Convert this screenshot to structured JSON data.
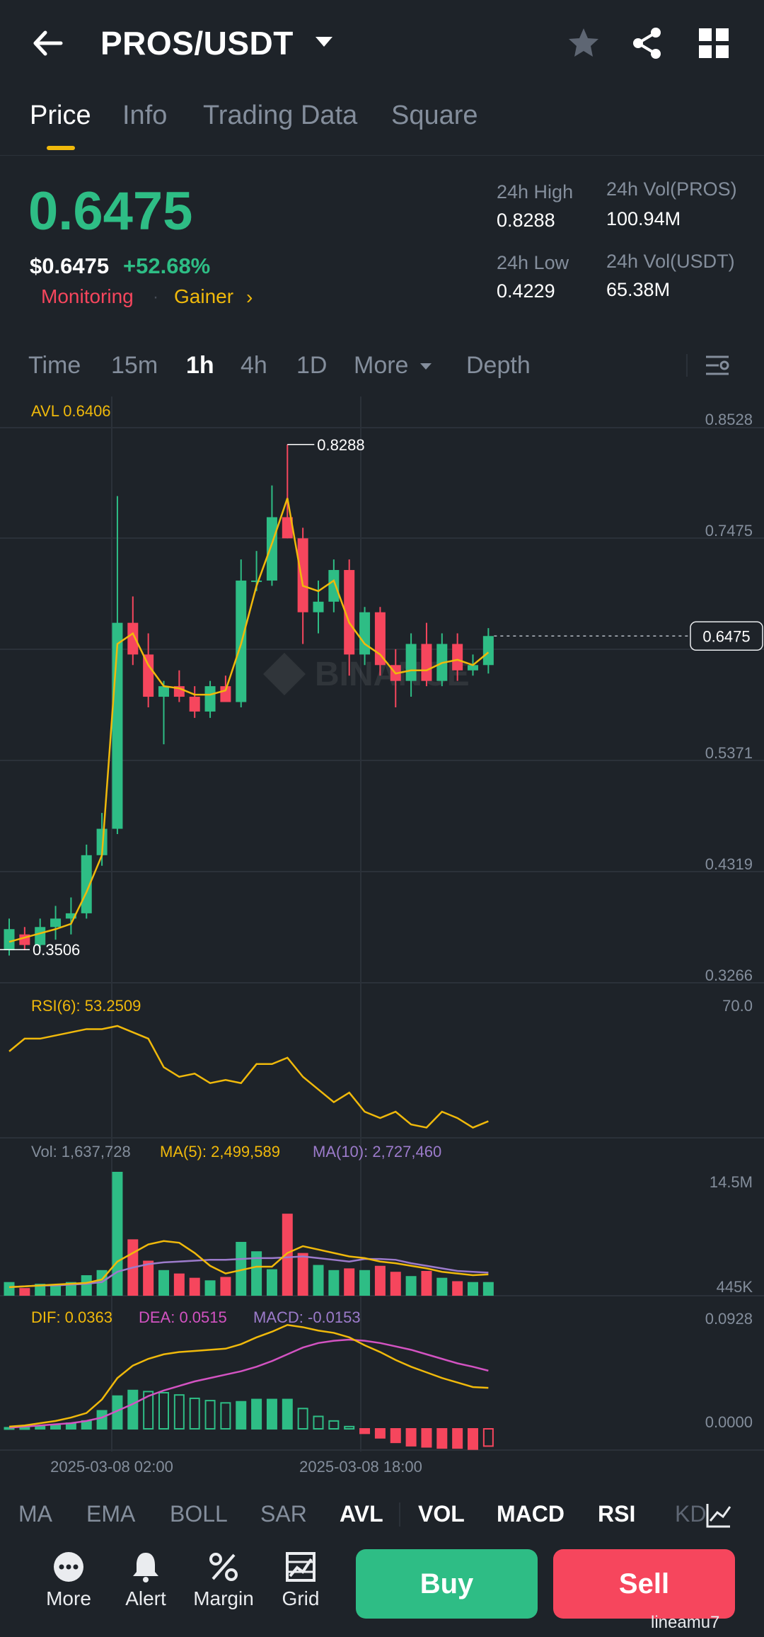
{
  "header": {
    "pair": "PROS/USDT",
    "icons": [
      "back-arrow-icon",
      "caret-down-icon",
      "star-icon",
      "share-icon",
      "grid-icon"
    ]
  },
  "tabs": [
    {
      "label": "Price",
      "active": true
    },
    {
      "label": "Info",
      "active": false
    },
    {
      "label": "Trading Data",
      "active": false
    },
    {
      "label": "Square",
      "active": false
    }
  ],
  "ticker": {
    "last_price": "0.6475",
    "usd_price": "$0.6475",
    "change_pct": "+52.68%",
    "tag_monitoring": "Monitoring",
    "tag_gainer": "Gainer",
    "high_label": "24h High",
    "high_value": "0.8288",
    "low_label": "24h Low",
    "low_value": "0.4229",
    "vol_base_label": "24h Vol(PROS)",
    "vol_base_value": "100.94M",
    "vol_quote_label": "24h Vol(USDT)",
    "vol_quote_value": "65.38M"
  },
  "intervals": [
    {
      "label": "Time",
      "active": false
    },
    {
      "label": "15m",
      "active": false
    },
    {
      "label": "1h",
      "active": true
    },
    {
      "label": "4h",
      "active": false
    },
    {
      "label": "1D",
      "active": false
    },
    {
      "label": "More",
      "active": false
    },
    {
      "label": "Depth",
      "active": false
    }
  ],
  "colors": {
    "up": "#2ebd85",
    "down": "#f6465d",
    "accent": "#f0b90b",
    "purple": "#9c7bcb",
    "pink": "#d353c2",
    "background": "#1e2329"
  },
  "chart_data": {
    "type": "candlestick",
    "interval": "1h",
    "avl_label": "AVL 0.6406",
    "price_ticks": [
      "0.8528",
      "0.7475",
      "0.6475",
      "0.5371",
      "0.4319",
      "0.3266"
    ],
    "y_range": [
      0.3266,
      0.8528
    ],
    "current_price": "0.6475",
    "high_marker": "0.8288",
    "low_marker": "0.3506",
    "x_tick_labels": [
      "2025-03-08 02:00",
      "2025-03-08 18:00"
    ],
    "candles": [
      {
        "o": 0.35,
        "h": 0.38,
        "l": 0.345,
        "c": 0.37
      },
      {
        "o": 0.365,
        "h": 0.372,
        "l": 0.35,
        "c": 0.355
      },
      {
        "o": 0.355,
        "h": 0.38,
        "l": 0.352,
        "c": 0.372
      },
      {
        "o": 0.372,
        "h": 0.392,
        "l": 0.36,
        "c": 0.38
      },
      {
        "o": 0.38,
        "h": 0.4,
        "l": 0.365,
        "c": 0.385
      },
      {
        "o": 0.385,
        "h": 0.45,
        "l": 0.38,
        "c": 0.44
      },
      {
        "o": 0.44,
        "h": 0.48,
        "l": 0.43,
        "c": 0.465
      },
      {
        "o": 0.465,
        "h": 0.78,
        "l": 0.46,
        "c": 0.66
      },
      {
        "o": 0.66,
        "h": 0.685,
        "l": 0.62,
        "c": 0.63
      },
      {
        "o": 0.63,
        "h": 0.65,
        "l": 0.58,
        "c": 0.59
      },
      {
        "o": 0.59,
        "h": 0.605,
        "l": 0.545,
        "c": 0.6
      },
      {
        "o": 0.6,
        "h": 0.615,
        "l": 0.585,
        "c": 0.59
      },
      {
        "o": 0.59,
        "h": 0.6,
        "l": 0.57,
        "c": 0.576
      },
      {
        "o": 0.576,
        "h": 0.605,
        "l": 0.57,
        "c": 0.6
      },
      {
        "o": 0.6,
        "h": 0.61,
        "l": 0.585,
        "c": 0.585
      },
      {
        "o": 0.585,
        "h": 0.72,
        "l": 0.58,
        "c": 0.7
      },
      {
        "o": 0.7,
        "h": 0.728,
        "l": 0.69,
        "c": 0.7
      },
      {
        "o": 0.7,
        "h": 0.79,
        "l": 0.695,
        "c": 0.76
      },
      {
        "o": 0.76,
        "h": 0.8288,
        "l": 0.74,
        "c": 0.74
      },
      {
        "o": 0.74,
        "h": 0.75,
        "l": 0.64,
        "c": 0.67
      },
      {
        "o": 0.67,
        "h": 0.7,
        "l": 0.65,
        "c": 0.68
      },
      {
        "o": 0.68,
        "h": 0.72,
        "l": 0.67,
        "c": 0.71
      },
      {
        "o": 0.71,
        "h": 0.72,
        "l": 0.61,
        "c": 0.63
      },
      {
        "o": 0.63,
        "h": 0.675,
        "l": 0.62,
        "c": 0.67
      },
      {
        "o": 0.67,
        "h": 0.675,
        "l": 0.61,
        "c": 0.62
      },
      {
        "o": 0.62,
        "h": 0.635,
        "l": 0.58,
        "c": 0.605
      },
      {
        "o": 0.605,
        "h": 0.65,
        "l": 0.59,
        "c": 0.64
      },
      {
        "o": 0.64,
        "h": 0.66,
        "l": 0.6,
        "c": 0.605
      },
      {
        "o": 0.605,
        "h": 0.65,
        "l": 0.6,
        "c": 0.64
      },
      {
        "o": 0.64,
        "h": 0.65,
        "l": 0.605,
        "c": 0.615
      },
      {
        "o": 0.615,
        "h": 0.63,
        "l": 0.61,
        "c": 0.62
      },
      {
        "o": 0.62,
        "h": 0.655,
        "l": 0.612,
        "c": 0.6475
      }
    ],
    "avl_line": [
      0.358,
      0.362,
      0.366,
      0.37,
      0.375,
      0.405,
      0.44,
      0.64,
      0.65,
      0.62,
      0.6,
      0.598,
      0.592,
      0.592,
      0.596,
      0.64,
      0.695,
      0.735,
      0.778,
      0.695,
      0.69,
      0.7,
      0.66,
      0.64,
      0.63,
      0.612,
      0.615,
      0.615,
      0.622,
      0.625,
      0.62,
      0.632
    ],
    "rsi": {
      "label": "RSI(6): 53.2509",
      "tick": "70.0",
      "values": [
        82,
        86,
        86,
        87,
        88,
        89,
        89,
        90,
        88,
        86,
        77,
        74,
        75,
        72,
        73,
        72,
        78,
        78,
        80,
        74,
        70,
        66,
        69,
        63,
        61,
        63,
        59,
        58,
        63,
        61,
        58,
        60
      ]
    },
    "volume": {
      "vol_label": "Vol: 1,637,728",
      "ma5_label": "MA(5): 2,499,589",
      "ma10_label": "MA(10): 2,727,460",
      "ticks": [
        "14.5M",
        "445K"
      ],
      "bars": [
        1.6,
        0.9,
        1.4,
        1.3,
        1.6,
        2.4,
        3.0,
        14.5,
        6.6,
        4.1,
        3.0,
        2.6,
        2.1,
        1.8,
        2.2,
        6.3,
        5.2,
        3.1,
        9.6,
        5.0,
        3.6,
        3.0,
        3.2,
        3.0,
        3.5,
        2.8,
        2.3,
        2.9,
        2.1,
        1.7,
        1.6,
        1.6
      ],
      "ma5": [
        1.0,
        1.1,
        1.2,
        1.3,
        1.4,
        1.5,
        1.9,
        4.0,
        5.0,
        6.0,
        6.4,
        6.2,
        5.0,
        3.5,
        2.6,
        3.0,
        3.4,
        3.4,
        5.0,
        5.8,
        5.4,
        5.0,
        4.6,
        4.4,
        4.0,
        3.8,
        3.5,
        3.2,
        2.8,
        2.6,
        2.4,
        2.5
      ],
      "ma10": [
        1.0,
        1.1,
        1.2,
        1.2,
        1.3,
        1.4,
        1.6,
        2.8,
        3.3,
        3.7,
        3.9,
        4.0,
        4.1,
        4.2,
        4.2,
        4.3,
        4.4,
        4.4,
        4.5,
        4.6,
        4.4,
        4.2,
        4.0,
        4.3,
        4.3,
        4.2,
        3.8,
        3.5,
        3.2,
        2.9,
        2.8,
        2.7
      ]
    },
    "macd": {
      "dif_label": "DIF: 0.0363",
      "dea_label": "DEA: 0.0515",
      "macd_label": "MACD: -0.0153",
      "ticks": [
        "0.0928",
        "0.0000"
      ],
      "dif": [
        0.002,
        0.003,
        0.005,
        0.007,
        0.01,
        0.014,
        0.026,
        0.045,
        0.056,
        0.062,
        0.066,
        0.068,
        0.069,
        0.07,
        0.071,
        0.075,
        0.081,
        0.086,
        0.092,
        0.09,
        0.087,
        0.085,
        0.081,
        0.074,
        0.068,
        0.061,
        0.055,
        0.05,
        0.045,
        0.041,
        0.037,
        0.0363
      ],
      "dea": [
        0.001,
        0.002,
        0.003,
        0.004,
        0.005,
        0.007,
        0.01,
        0.016,
        0.022,
        0.029,
        0.034,
        0.038,
        0.042,
        0.045,
        0.048,
        0.051,
        0.055,
        0.06,
        0.066,
        0.072,
        0.076,
        0.078,
        0.079,
        0.078,
        0.076,
        0.073,
        0.07,
        0.066,
        0.062,
        0.058,
        0.055,
        0.0515
      ],
      "hist": [
        0.001,
        0.001,
        0.002,
        0.003,
        0.005,
        0.007,
        0.016,
        0.029,
        0.034,
        0.033,
        0.032,
        0.03,
        0.027,
        0.025,
        0.023,
        0.024,
        0.026,
        0.026,
        0.026,
        0.018,
        0.011,
        0.007,
        0.002,
        -0.004,
        -0.008,
        -0.012,
        -0.015,
        -0.016,
        -0.017,
        -0.017,
        -0.018,
        -0.0153
      ]
    }
  },
  "indicators": [
    {
      "label": "MA",
      "bold": false
    },
    {
      "label": "EMA",
      "bold": false
    },
    {
      "label": "BOLL",
      "bold": false
    },
    {
      "label": "SAR",
      "bold": false
    },
    {
      "label": "AVL",
      "bold": true
    },
    {
      "label": "VOL",
      "bold": true
    },
    {
      "label": "MACD",
      "bold": true
    },
    {
      "label": "RSI",
      "bold": true
    },
    {
      "label": "KD",
      "bold": false
    }
  ],
  "bottom_bar": {
    "more": "More",
    "alert": "Alert",
    "margin": "Margin",
    "grid": "Grid",
    "buy": "Buy",
    "sell": "Sell"
  },
  "watermark": {
    "brand": "BINANCE",
    "user": "lineamu7"
  }
}
